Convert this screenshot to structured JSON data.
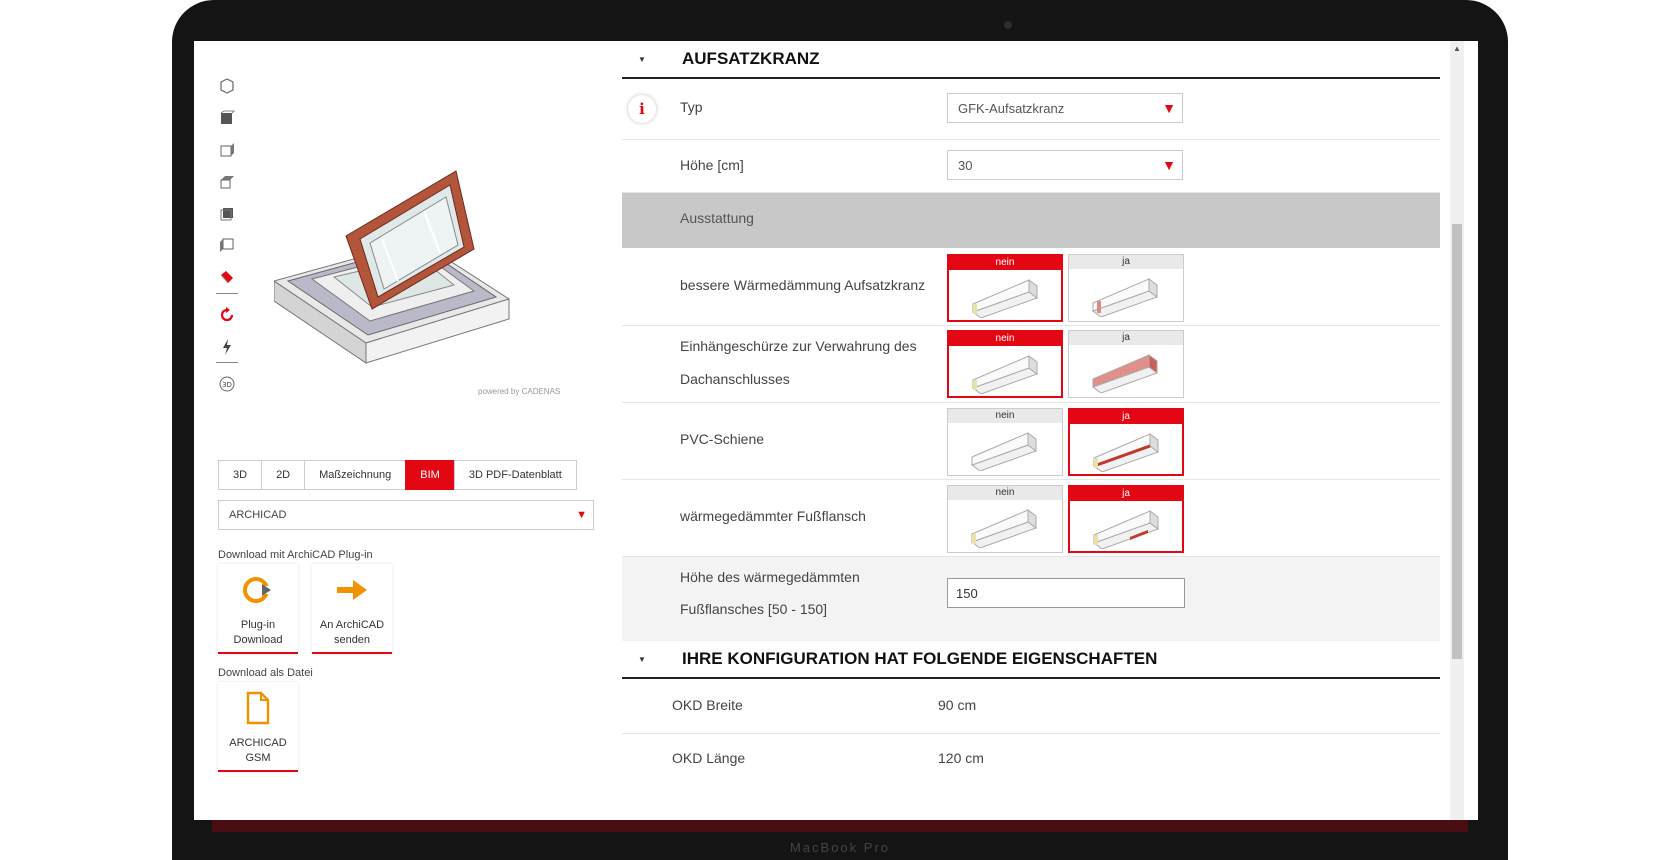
{
  "brand_text": "MacBook Pro",
  "left": {
    "powered_by": "powered by CADENAS",
    "tabs": [
      {
        "label": "3D",
        "active": false
      },
      {
        "label": "2D",
        "active": false
      },
      {
        "label": "Maßzeichnung",
        "active": false
      },
      {
        "label": "BIM",
        "active": true
      },
      {
        "label": "3D PDF-Datenblatt",
        "active": false
      }
    ],
    "format_select": "ARCHICAD",
    "download_plugin_label": "Download mit ArchiCAD Plug-in",
    "plugin_download_label": "Plug-in Download",
    "send_archicad_label": "An ArchiCAD senden",
    "download_file_label": "Download als Datei",
    "gsm_label": "ARCHICAD GSM"
  },
  "right": {
    "section1_title": "AUFSATZKRANZ",
    "typ_label": "Typ",
    "typ_value": "GFK-Aufsatzkranz",
    "hoehe_label": "Höhe [cm]",
    "hoehe_value": "30",
    "ausstattung_label": "Ausstattung",
    "option_rows": [
      {
        "label": "bessere Wärmedämmung Aufsatzkranz",
        "selected": "nein"
      },
      {
        "label": "Einhängeschürze zur Verwahrung des Dachanschlusses",
        "selected": "nein"
      },
      {
        "label": "PVC-Schiene",
        "selected": "ja"
      },
      {
        "label": "wärmegedämmter Fußflansch",
        "selected": "ja"
      }
    ],
    "opt_no": "nein",
    "opt_yes": "ja",
    "flansch_height_label_1": "Höhe des wärmegedämmten",
    "flansch_height_label_2": "Fußflansches [50 - 150]",
    "flansch_height_value": "150",
    "section2_title": "IHRE KONFIGURATION HAT FOLGENDE EIGENSCHAFTEN",
    "properties": [
      {
        "key": "OKD Breite",
        "value": "90 cm"
      },
      {
        "key": "OKD Länge",
        "value": "120 cm"
      }
    ]
  },
  "colors": {
    "accent": "#e30613",
    "orange": "#f39200"
  }
}
